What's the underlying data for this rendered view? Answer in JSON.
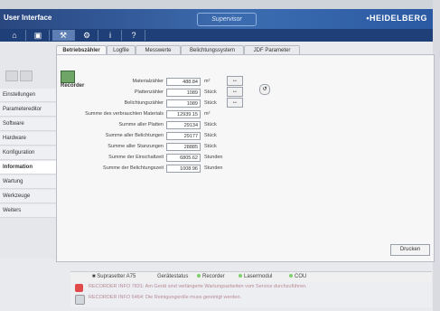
{
  "window": {
    "title": "User Interface",
    "badge": "Supervisor",
    "brand": "HEIDELBERG"
  },
  "toolbar": {
    "icons": [
      "home-icon",
      "save-icon",
      "tools-icon",
      "wrench-icon",
      "info-icon",
      "help-icon"
    ],
    "glyphs": [
      "⌂",
      "▣",
      "⚒",
      "⚙",
      "i",
      "?"
    ],
    "active_index": 2
  },
  "sidebar": {
    "items": [
      "Einstellungen",
      "Parametereditor",
      "Software",
      "Hardware",
      "Konfiguration",
      "Information",
      "Wartung",
      "Werkzeuge",
      "Weiters"
    ],
    "active_index": 5
  },
  "tabs": [
    "Betriebszähler",
    "Logfile",
    "Messwerte",
    "Belichtungssystem",
    "JDF Parameter"
  ],
  "recorder": {
    "label": "Recorder"
  },
  "counters": [
    {
      "label": "Materialzähler",
      "value": "488.84",
      "unit": "m²"
    },
    {
      "label": "Plattenzähler",
      "value": "1089",
      "unit": "Stück"
    },
    {
      "label": "Belichtungszähler",
      "value": "1089",
      "unit": "Stück"
    },
    {
      "label": "Summe des verbrauchten Materials",
      "value": "12939.15",
      "unit": "m²"
    },
    {
      "label": "Summe aller Platten",
      "value": "29134",
      "unit": "Stück"
    },
    {
      "label": "Summe aller Belichtungen",
      "value": "29177",
      "unit": "Stück"
    },
    {
      "label": "Summe aller Stanzungen",
      "value": "28885",
      "unit": "Stück"
    },
    {
      "label": "Summe der Einschaltzeit",
      "value": "6805.62",
      "unit": "Stunden"
    },
    {
      "label": "Summe der Belichtungszeit",
      "value": "1008.96",
      "unit": "Stunden"
    }
  ],
  "print_button": "Drucken",
  "status_bar": {
    "device": "Suprasetter A75",
    "device_status_label": "Gerätestatus",
    "items": [
      "Recorder",
      "Lasermodul",
      "COU"
    ]
  },
  "alerts": [
    {
      "text": "RECORDER INFO 7831: Am Gerät sind verlängerte Wartungsarbeiten vom Service durchzuführen.",
      "color": "#e04a4a"
    },
    {
      "text": "RECORDER INFO 6464: Die Reinigungsrolle muss gereinigt werden.",
      "color": "#d3d6da"
    }
  ]
}
